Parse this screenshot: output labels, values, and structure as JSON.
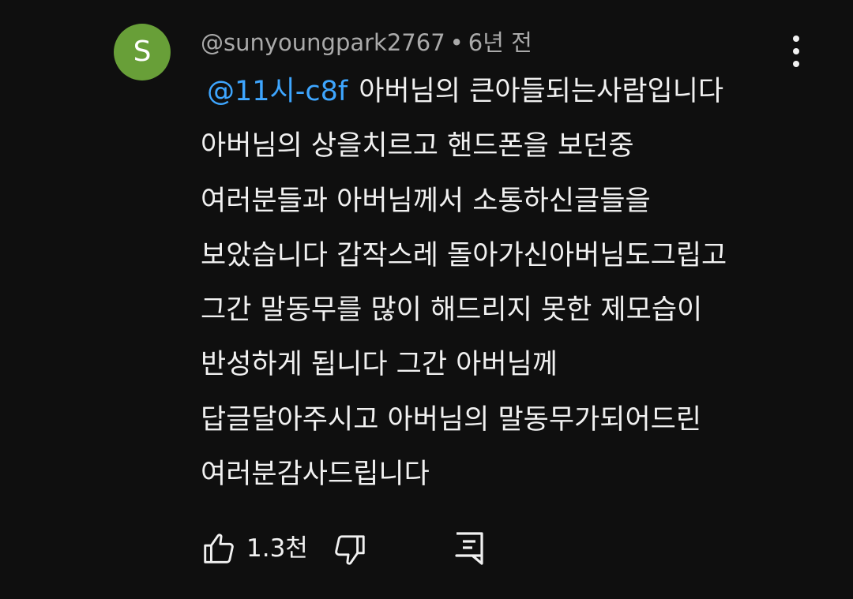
{
  "author": {
    "avatar_letter": "S",
    "avatar_color": "#689f38",
    "handle": "@sunyoungpark2767",
    "separator": "•",
    "time": "6년 전"
  },
  "comment": {
    "mention": "@11시-c8f",
    "lines": [
      "아버님의 큰아들되는사람입니다",
      "아버님의 상을치르고 핸드폰을 보던중",
      "여러분들과 아버님께서 소통하신글들을",
      "보았습니다 갑작스레 돌아가신아버님도그립고",
      "그간 말동무를 많이 해드리지 못한 제모습이",
      "반성하게 됩니다 그간 아버님께",
      "답글달아주시고 아버님의 말동무가되어드린",
      "여러분감사드립니다"
    ]
  },
  "actions": {
    "like_count": "1.3천",
    "like_icon": "thumbs-up-icon",
    "dislike_icon": "thumbs-down-icon",
    "reply_icon": "comment-reply-icon",
    "more_icon": "more-vert-icon"
  },
  "colors": {
    "background": "#0f0f0f",
    "text": "#f1f1f1",
    "secondary_text": "#aaaaaa",
    "mention": "#3ea6ff"
  }
}
